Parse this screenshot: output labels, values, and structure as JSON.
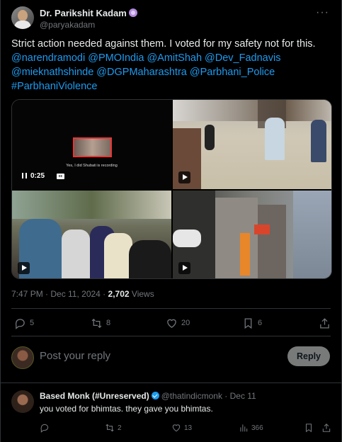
{
  "tweet": {
    "author_name": "Dr. Parikshit Kadam",
    "author_handle": "@paryakadam",
    "text_plain": "Strict action needed against them. I voted for my safety not for this.",
    "mentions_line1": "@narendramodi @PMOIndia @AmitShah @Dev_Fadnavis",
    "mentions_line2": "@mieknathshinde @DGPMaharashtra @Parbhani_Police",
    "hashtag": "#ParbhaniViolence",
    "video": {
      "caption": "Yes, I did Shubati is recording",
      "time": "0:25",
      "cc_label": "cc"
    },
    "timestamp": "7:47 PM · Dec 11, 2024 ·",
    "views_count": "2,702",
    "views_label": "Views",
    "stats": {
      "replies": "5",
      "retweets": "8",
      "likes": "20",
      "bookmarks": "6"
    },
    "link_color": "#1d9bf0"
  },
  "reply_box": {
    "placeholder": "Post your reply",
    "button_label": "Reply"
  },
  "comment": {
    "author_name": "Based Monk (#Unreserved)",
    "author_handle": "@thatindicmonk · Dec 11",
    "text": "you voted for bhimtas. they gave you bhimtas.",
    "stats": {
      "retweets": "2",
      "likes": "13",
      "views": "366"
    }
  }
}
